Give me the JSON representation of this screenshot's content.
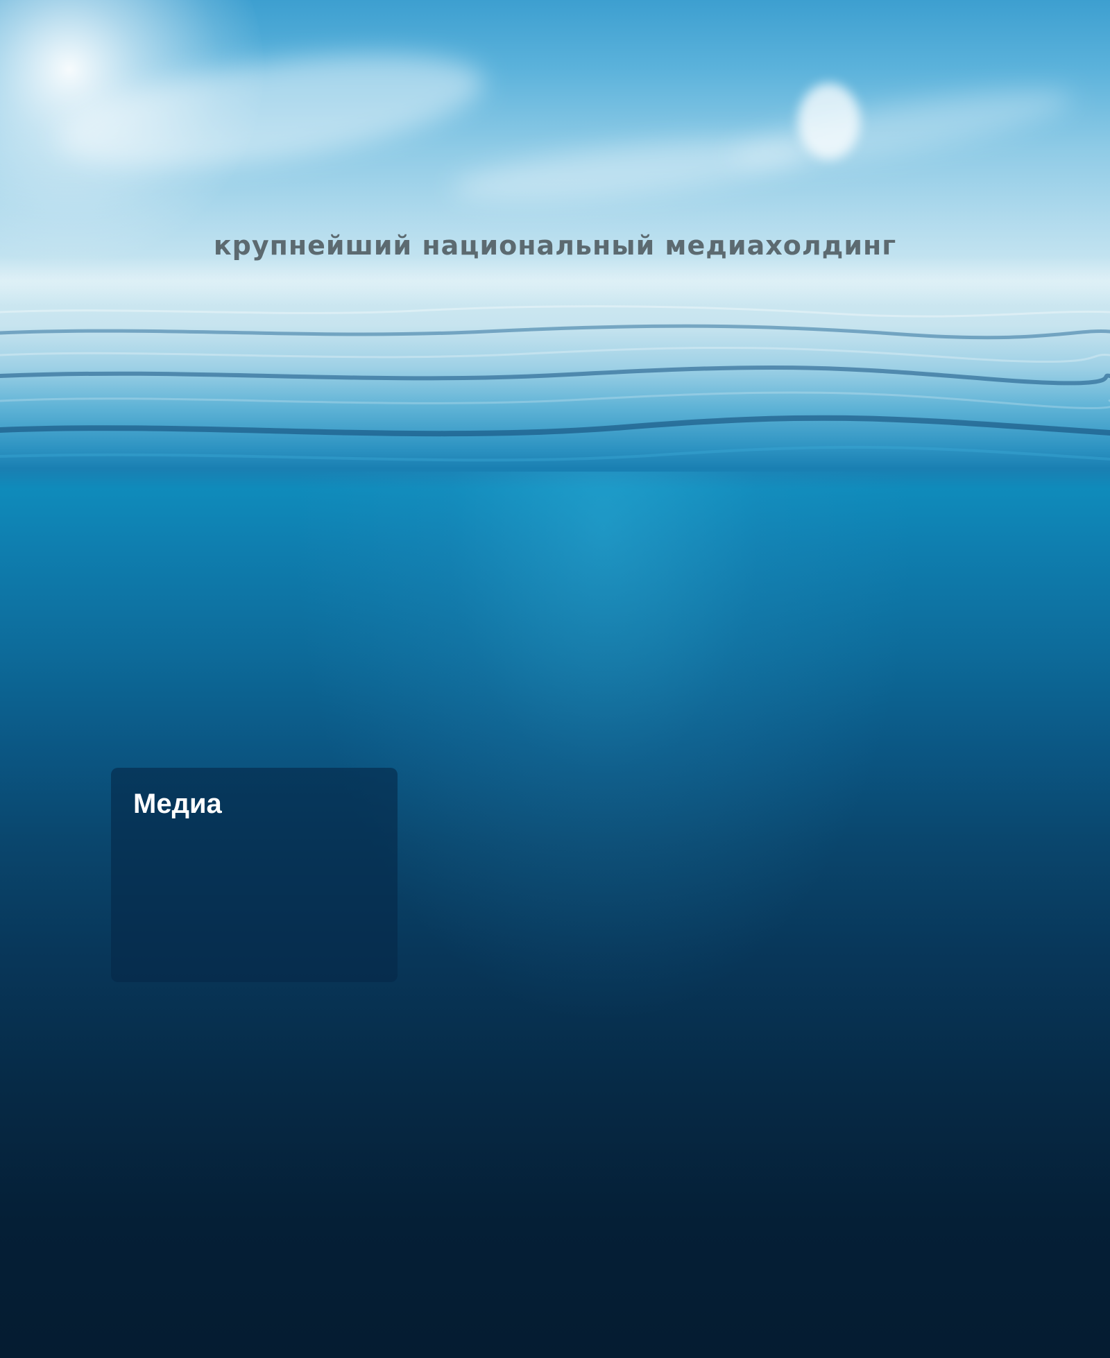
{
  "hero": {
    "tagline": "крупнейший национальный медиахолдинг"
  },
  "media_card": {
    "title": "Медиа"
  },
  "colors": {
    "tagline_text": "#5c6a70",
    "card_background": "#05284a",
    "card_title": "#ffffff",
    "deep_water": "#051c31"
  }
}
